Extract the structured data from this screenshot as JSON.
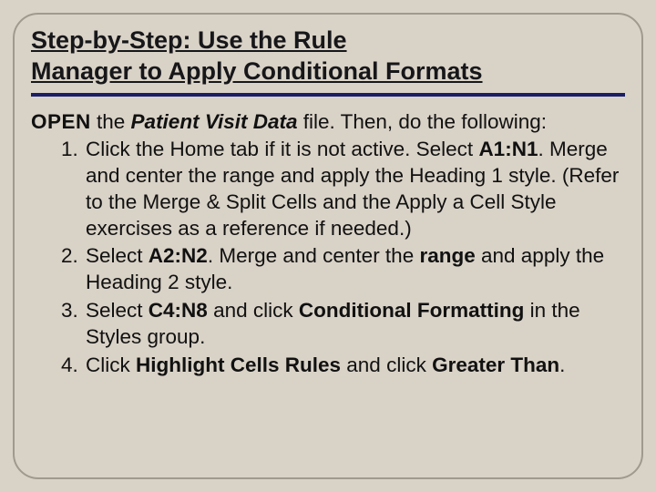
{
  "title": {
    "line1": "Step-by-Step: Use the Rule",
    "line2": "Manager to Apply Conditional Formats"
  },
  "intro": {
    "open": "OPEN",
    "mid1": " the ",
    "file": "Patient Visit Data",
    "mid2": " file. Then, do the following:"
  },
  "steps": {
    "s1": {
      "t1": "Click the Home tab if it is not active. Select ",
      "range": "A1:N1",
      "t2": ". Merge and center the range and apply the Heading 1 style. (Refer to the Merge & Split Cells and the Apply a Cell Style exercises as a reference if needed.)"
    },
    "s2": {
      "t1": "Select ",
      "range": "A2:N2",
      "t2": ". Merge and center the ",
      "rangeword": "range",
      "t3": " and apply the Heading 2 style."
    },
    "s3": {
      "t1": "Select ",
      "range": "C4:N8",
      "t2": " and click ",
      "cmd": "Conditional Formatting",
      "t3": " in the Styles group."
    },
    "s4": {
      "t1": "Click ",
      "cmd1": "Highlight Cells Rules",
      "t2": " and click ",
      "cmd2": "Greater Than",
      "t3": "."
    }
  }
}
